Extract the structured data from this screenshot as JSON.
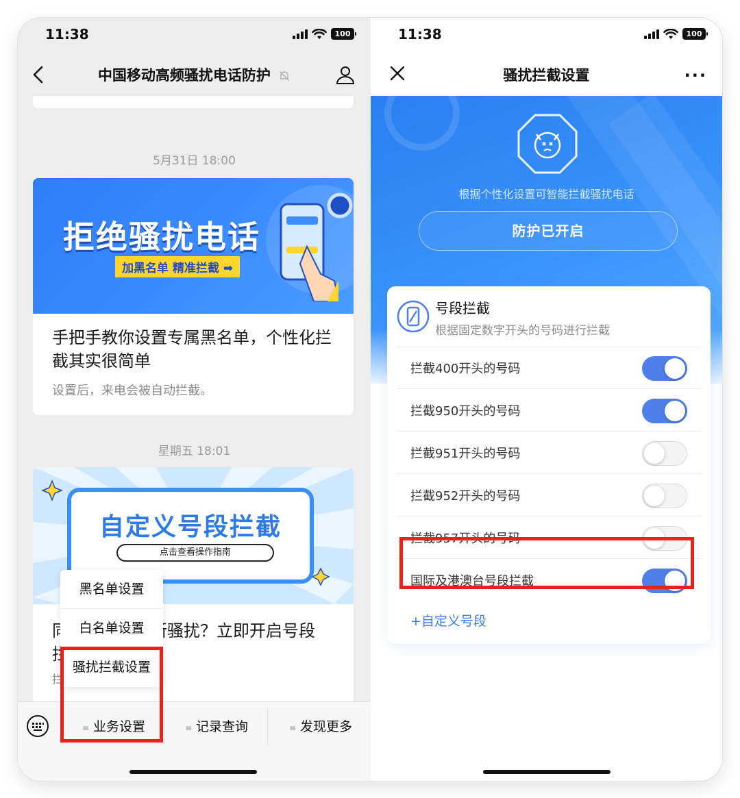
{
  "status": {
    "time": "11:38",
    "battery": "100"
  },
  "left": {
    "nav": {
      "title": "中国移动高频骚扰电话防护"
    },
    "feed": {
      "ts1": "5月31日 18:00",
      "article1": {
        "banner_title": "拒绝骚扰电话",
        "banner_pill": "加黑名单 精准拦截 ➡",
        "title": "手把手教你设置专属黑名单，个性化拦截其实很简单",
        "desc": "设置后，来电会被自动拦截。"
      },
      "ts2": "星期五 18:01",
      "article2": {
        "banner_title": "自定义号段拦截",
        "banner_search": "点击查看操作指南",
        "title_visible_a": "同",
        "title_visible_b": "所骚扰？立即开启号段",
        "title_visible_c": "拦",
        "desc_visible": "拦"
      }
    },
    "popup": [
      "黑名单设置",
      "白名单设置",
      "骚扰拦截设置"
    ],
    "tabs": [
      "业务设置",
      "记录查询",
      "发现更多"
    ]
  },
  "right": {
    "nav": {
      "title": "骚扰拦截设置"
    },
    "hero": {
      "desc": "根据个性化设置可智能拦截骚扰电话",
      "button": "防护已开启"
    },
    "panel": {
      "title": "号段拦截",
      "subtitle": "根据固定数字开头的号码进行拦截",
      "rows": [
        {
          "label": "拦截400开头的号码",
          "on": true
        },
        {
          "label": "拦截950开头的号码",
          "on": true
        },
        {
          "label": "拦截951开头的号码",
          "on": false
        },
        {
          "label": "拦截952开头的号码",
          "on": false
        },
        {
          "label": "拦截957开头的号码",
          "on": false
        },
        {
          "label": "国际及港澳台号段拦截",
          "on": true
        }
      ],
      "add_custom": "+自定义号段"
    }
  },
  "colors": {
    "accent": "#4f7fe8",
    "highlight": "#e8231a",
    "hero": "#3a93fb"
  }
}
